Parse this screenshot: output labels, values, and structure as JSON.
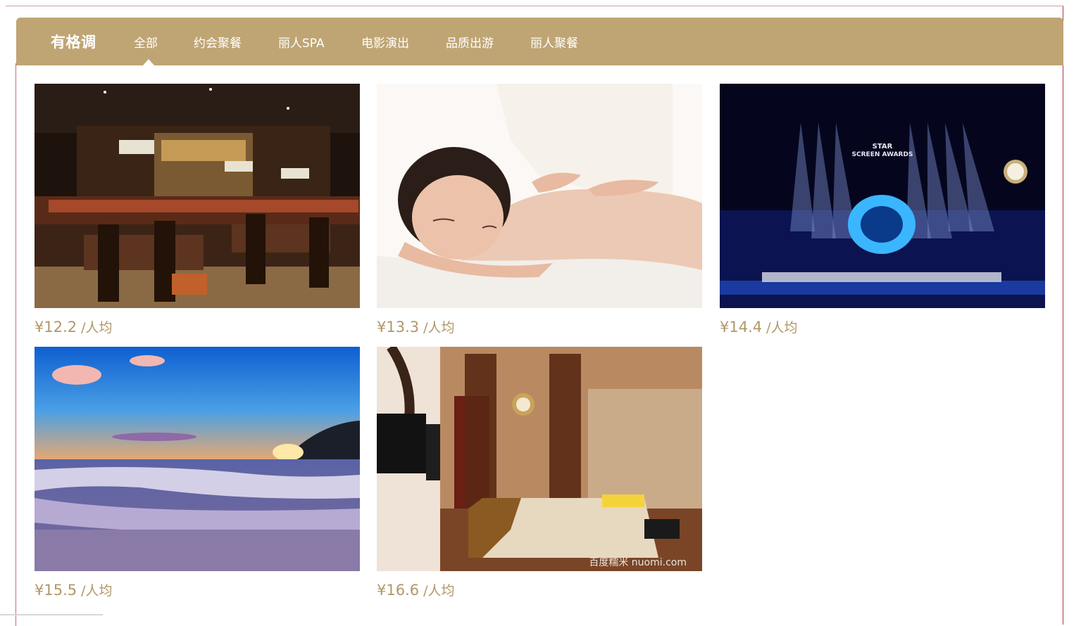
{
  "header": {
    "brand": "有格调",
    "tabs": [
      {
        "label": "全部",
        "active": true
      },
      {
        "label": "约会聚餐",
        "active": false
      },
      {
        "label": "丽人SPA",
        "active": false
      },
      {
        "label": "电影演出",
        "active": false
      },
      {
        "label": "品质出游",
        "active": false
      },
      {
        "label": "丽人聚餐",
        "active": false
      }
    ]
  },
  "items": [
    {
      "image": "restaurant-interior",
      "price": "¥12.2",
      "unit": "/人均"
    },
    {
      "image": "spa-back-massage",
      "price": "¥13.3",
      "unit": "/人均"
    },
    {
      "image": "concert-stage",
      "price": "¥14.4",
      "unit": "/人均",
      "stage_text": [
        "STAR",
        "SCREEN AWARDS"
      ]
    },
    {
      "image": "beach-sunset",
      "price": "¥15.5",
      "unit": "/人均"
    },
    {
      "image": "spa-room-bed",
      "price": "¥16.6",
      "unit": "/人均",
      "watermark": "百度糯米 nuomi.com"
    }
  ],
  "colors": {
    "header_bg": "#bfa574",
    "price_text": "#b09768",
    "frame_border": "#b03a48"
  }
}
